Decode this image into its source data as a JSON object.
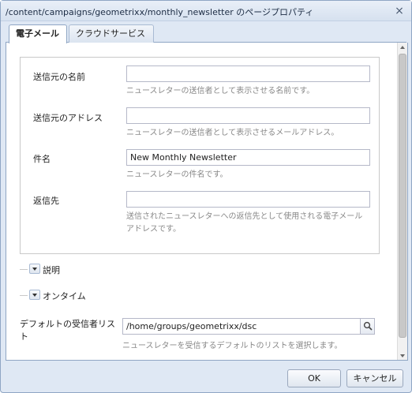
{
  "window": {
    "title": "/content/campaigns/geometrixx/monthly_newsletter のページプロパティ",
    "close_icon": "close-icon"
  },
  "tabs": [
    {
      "label": "電子メール",
      "active": true
    },
    {
      "label": "クラウドサービス",
      "active": false
    }
  ],
  "email_fields": {
    "sender_name": {
      "label": "送信元の名前",
      "value": "",
      "help": "ニュースレターの送信者として表示させる名前です。"
    },
    "sender_address": {
      "label": "送信元のアドレス",
      "value": "",
      "help": "ニュースレターの送信者として表示させるメールアドレス。"
    },
    "subject": {
      "label": "件名",
      "value": "New Monthly Newsletter",
      "help": "ニュースレターの件名です。"
    },
    "reply_to": {
      "label": "返信先",
      "value": "",
      "help": "送信されたニュースレターへの返信先として使用される電子メールアドレスです。"
    }
  },
  "sections": {
    "description": {
      "label": "説明",
      "collapsed": true
    },
    "ontime": {
      "label": "オンタイム",
      "collapsed": true
    }
  },
  "default_list": {
    "label": "デフォルトの受信者リスト",
    "value": "/home/groups/geometrixx/dsc",
    "help": "ニュースレターを受信するデフォルトのリストを選択します。",
    "search_icon": "search-icon"
  },
  "buttons": {
    "ok": "OK",
    "cancel": "キャンセル"
  }
}
